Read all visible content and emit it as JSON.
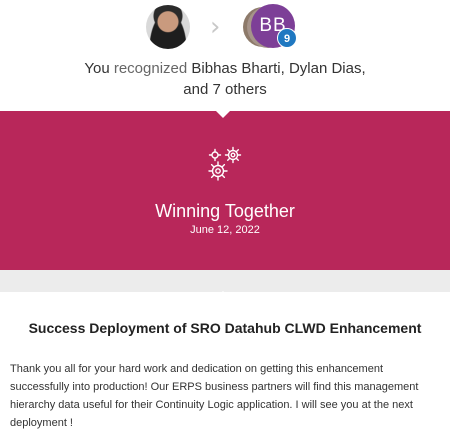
{
  "header": {
    "recipient_avatar_initials": "BB",
    "others_badge": "9",
    "recognition_prefix": "You ",
    "recognition_verb": "recognized ",
    "recognition_names": "Bibhas Bharti, Dylan Dias,",
    "recognition_suffix": "and 7 others"
  },
  "banner": {
    "icon": "gears-icon",
    "title": "Winning Together",
    "date": "June 12, 2022",
    "color": "#b8275a"
  },
  "card": {
    "title": "Success Deployment of SRO Datahub CLWD Enhancement",
    "body": "Thank you all for your hard work and dedication on getting this enhancement successfully into production! Our ERPS business partners will find this management hierarchy data useful for their Continuity Logic application. I will see you at the next deployment !"
  }
}
